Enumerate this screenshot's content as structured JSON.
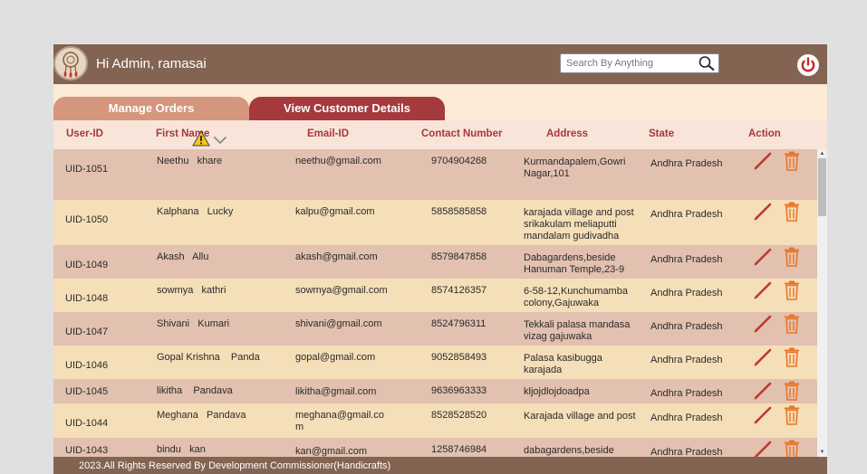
{
  "header": {
    "greeting": "Hi Admin, ramasai",
    "search_placeholder": "Search By Anything"
  },
  "tabs": [
    {
      "label": "Manage Orders",
      "active": false
    },
    {
      "label": "View Customer Details",
      "active": true
    }
  ],
  "columns": [
    "User-ID",
    "First Name",
    "Email-ID",
    "Contact Number",
    "Address",
    "State",
    "Action"
  ],
  "rows": [
    {
      "uid": "UID-1051",
      "name": "Neethu   khare",
      "email": "neethu@gmail.com",
      "phone": "9704904268",
      "address": "Kurmandapalem,Gowri Nagar,101",
      "state": "Andhra Pradesh"
    },
    {
      "uid": "UID-1050",
      "name": "Kalphana   Lucky",
      "email": "kalpu@gmail.com",
      "phone": "5858585858",
      "address": "karajada village and post srikakulam meliaputti mandalam gudivadha",
      "state": "Andhra Pradesh"
    },
    {
      "uid": "UID-1049",
      "name": "Akash   Allu",
      "email": "akash@gmail.com",
      "phone": "8579847858",
      "address": "Dabagardens,beside Hanuman Temple,23-9",
      "state": "Andhra Pradesh"
    },
    {
      "uid": "UID-1048",
      "name": "sowmya   kathri",
      "email": "sowmya@gmail.com",
      "phone": "8574126357",
      "address": "6-58-12,Kunchumamba colony,Gajuwaka",
      "state": "Andhra Pradesh"
    },
    {
      "uid": "UID-1047",
      "name": "Shivani   Kumari",
      "email": "shivani@gmail.com",
      "phone": "8524796311",
      "address": "Tekkali palasa mandasa vizag gajuwaka",
      "state": "Andhra Pradesh"
    },
    {
      "uid": "UID-1046",
      "name": "Gopal Krishna    Panda",
      "email": "gopal@gmail.com",
      "phone": "9052858493",
      "address": "Palasa kasibugga karajada",
      "state": "Andhra Pradesh"
    },
    {
      "uid": "UID-1045",
      "name": "likitha    Pandava",
      "email": "likitha@gmail.com",
      "phone": "9636963333",
      "address": "kljojdlojdoadpa",
      "state": "Andhra Pradesh"
    },
    {
      "uid": "UID-1044",
      "name": "Meghana   Pandava",
      "email": "meghana@gmail.com",
      "phone": "8528528520",
      "address": "Karajada village and post",
      "state": "Andhra Pradesh"
    },
    {
      "uid": "UID-1043",
      "name": "bindu   kan",
      "email": "kan@gmail.com",
      "phone": "1258746984",
      "address": "dabagardens,beside",
      "state": "Andhra Pradesh"
    }
  ],
  "footer": {
    "text": "2023.All Rights Reserved By Development Commissioner(Handicrafts)"
  },
  "colors": {
    "header_bg": "#836453",
    "tab_inactive": "#d4967c",
    "tab_active": "#a5393c",
    "row_odd": "#e2c1b0",
    "row_even": "#f5dfb8",
    "edit_icon": "#c0392b",
    "delete_icon": "#e8752a"
  },
  "icons": {
    "logo": "dreamcatcher-icon",
    "search": "search-icon",
    "power": "power-icon",
    "warning": "warning-icon",
    "sort": "chevron-down-icon",
    "edit": "pencil-icon",
    "delete": "trash-icon"
  }
}
